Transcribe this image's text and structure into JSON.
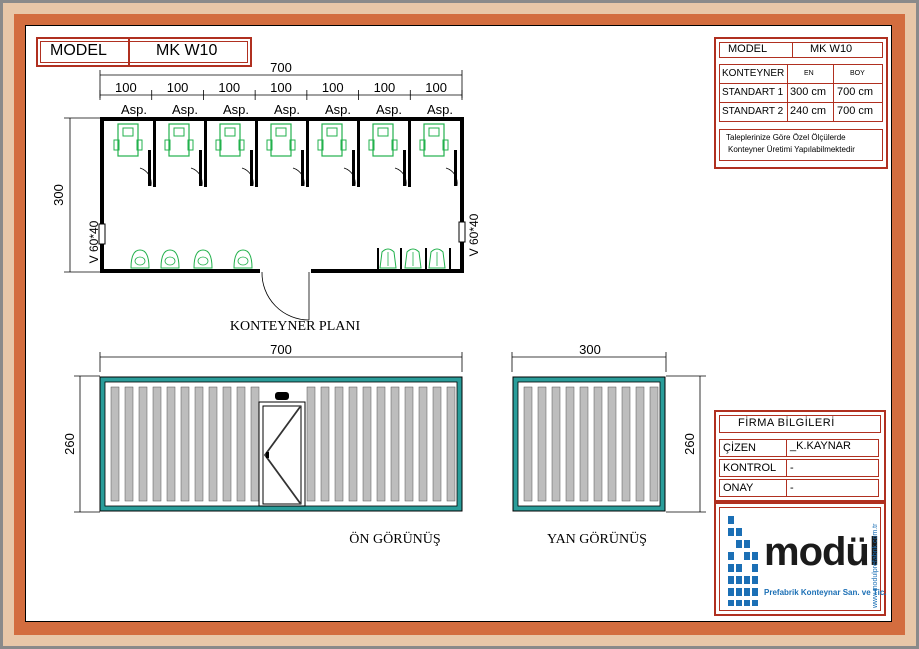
{
  "model_box": {
    "label": "MODEL",
    "value": "MK W10"
  },
  "info_table": {
    "model_label": "MODEL",
    "model_value": "MK W10",
    "header": [
      "KONTEYNER",
      "EN",
      "BOY"
    ],
    "rows": [
      [
        "STANDART 1",
        "300 cm",
        "700 cm"
      ],
      [
        "STANDART 2",
        "240 cm",
        "700 cm"
      ]
    ],
    "note_line1": "Taleplerinize Göre Özel Ölçülerde",
    "note_line2": "Konteyner Üretimi Yapılabilmektedir"
  },
  "plan": {
    "total_dim": "700",
    "segment_dims": [
      "100",
      "100",
      "100",
      "100",
      "100",
      "100",
      "100"
    ],
    "stall_labels": [
      "Asp.",
      "Asp.",
      "Asp.",
      "Asp.",
      "Asp.",
      "Asp.",
      "Asp."
    ],
    "height_dim": "300",
    "window_left": "V 60*40",
    "window_right": "V 60*40",
    "caption": "KONTEYNER PLANI"
  },
  "front_view": {
    "width_dim": "700",
    "height_dim": "260",
    "caption": "ÖN  GÖRÜNÜŞ"
  },
  "side_view": {
    "width_dim": "300",
    "height_dim": "260",
    "caption": "YAN  GÖRÜNÜŞ"
  },
  "firm": {
    "title": "FİRMA BİLGİLERİ",
    "rows": [
      {
        "label": "ÇİZEN",
        "value": "_K.KAYNAR"
      },
      {
        "label": "KONTROL",
        "value": "-"
      },
      {
        "label": "ONAY",
        "value": "-"
      }
    ]
  },
  "logo": {
    "brand": "modül",
    "subtitle": "Prefabrik Konteynar San. ve Tic.",
    "website": "www.modulprefabrik.com.tr"
  },
  "colors": {
    "frame_red": "#b03020",
    "border_orange": "#d36d3f",
    "container_teal": "#2a9d9a",
    "slat_gray": "#bdbdbd",
    "fixture_green": "#22b14c",
    "logo_blue": "#1b6fb5"
  }
}
